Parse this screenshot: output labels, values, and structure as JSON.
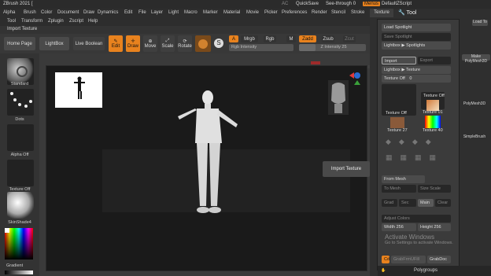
{
  "app": {
    "title": "ZBrush 2021 [",
    "ac": "AC",
    "quicksave": "QuickSave",
    "seethrough": "See-through  0",
    "menus_btn": "Menus",
    "script": "DefaultZScript"
  },
  "menu1": [
    "Alpha",
    "Brush",
    "Color",
    "Document",
    "Draw",
    "Dynamics",
    "Edit",
    "File",
    "Layer",
    "Light",
    "Macro",
    "Marker",
    "Material",
    "Movie",
    "Picker",
    "Preferences",
    "Render",
    "Stencil",
    "Stroke"
  ],
  "menu2": [
    "Tool",
    "Transform",
    "Zplugin",
    "Zscript",
    "Help"
  ],
  "import_label": "Import Texture",
  "toolbar": {
    "home": "Home Page",
    "lightbox": "LightBox",
    "live_boolean": "Live Boolean",
    "edit": "Edit",
    "draw": "Draw",
    "move": "Move",
    "scale": "Scale",
    "rotate": "Rotate",
    "a": "A",
    "mrgb": "Mrgb",
    "rgb": "Rgb",
    "m": "M",
    "zadd": "Zadd",
    "zsub": "Zsub",
    "zcut": "Zcut",
    "rgb_intensity": "Rgb Intensity",
    "z_intensity": "Z Intensity 25"
  },
  "z_intensity_value": 0.25,
  "left": {
    "standard": "Standard",
    "dots": "Dots",
    "alpha_off": "Alpha Off",
    "texture_off": "Texture Off",
    "material": "SkinShade4",
    "gradient": "Gradient"
  },
  "tool_header": {
    "texture_tab": "Texture",
    "tool_tab": "Tool"
  },
  "texture_popup": {
    "load_spotlight": "Load Spotlight",
    "save_spotlight": "Save Spotlight",
    "lightbox_spotlight": "Lightbox ▶ Spotlights",
    "import": "Import",
    "export": "Export",
    "lightbox_texture": "Lightbox ▶ Texture",
    "texture_off": "Texture Off",
    "texture_off_value": "0",
    "cells": [
      "Texture Off",
      "Texture Off",
      "Texture 01",
      "Texture 27",
      "Texture 40"
    ],
    "from_mesh": "From Mesh",
    "to_mesh": "To Mesh",
    "size_scale": "Size Scale",
    "grad": "Grad",
    "sec": "Sec",
    "main": "Main",
    "clear": "Clear",
    "adjust_colors": "Adjust Colors",
    "width": "Width 256",
    "height": "Height 256",
    "cd": "Cd",
    "grab_from": "GrabFrmUFill",
    "grabdoc": "GrabDoc"
  },
  "right_tool": {
    "load_tool": "Load To",
    "make_polymesh": "Make PolyMesh3D",
    "sphere": "SimpleBrush",
    "polymesh": "PolyMesh3D"
  },
  "tooltip": "Import Texture",
  "bottom": {
    "polygroups": "Polygroups",
    "move_label": "Move"
  },
  "watermark": {
    "line1": "Activate Windows",
    "line2": "Go to Settings to activate Windows."
  },
  "colors": {
    "accent": "#e8821e",
    "bg": "#3a3a3a",
    "canvas": "#1a1a1a"
  }
}
